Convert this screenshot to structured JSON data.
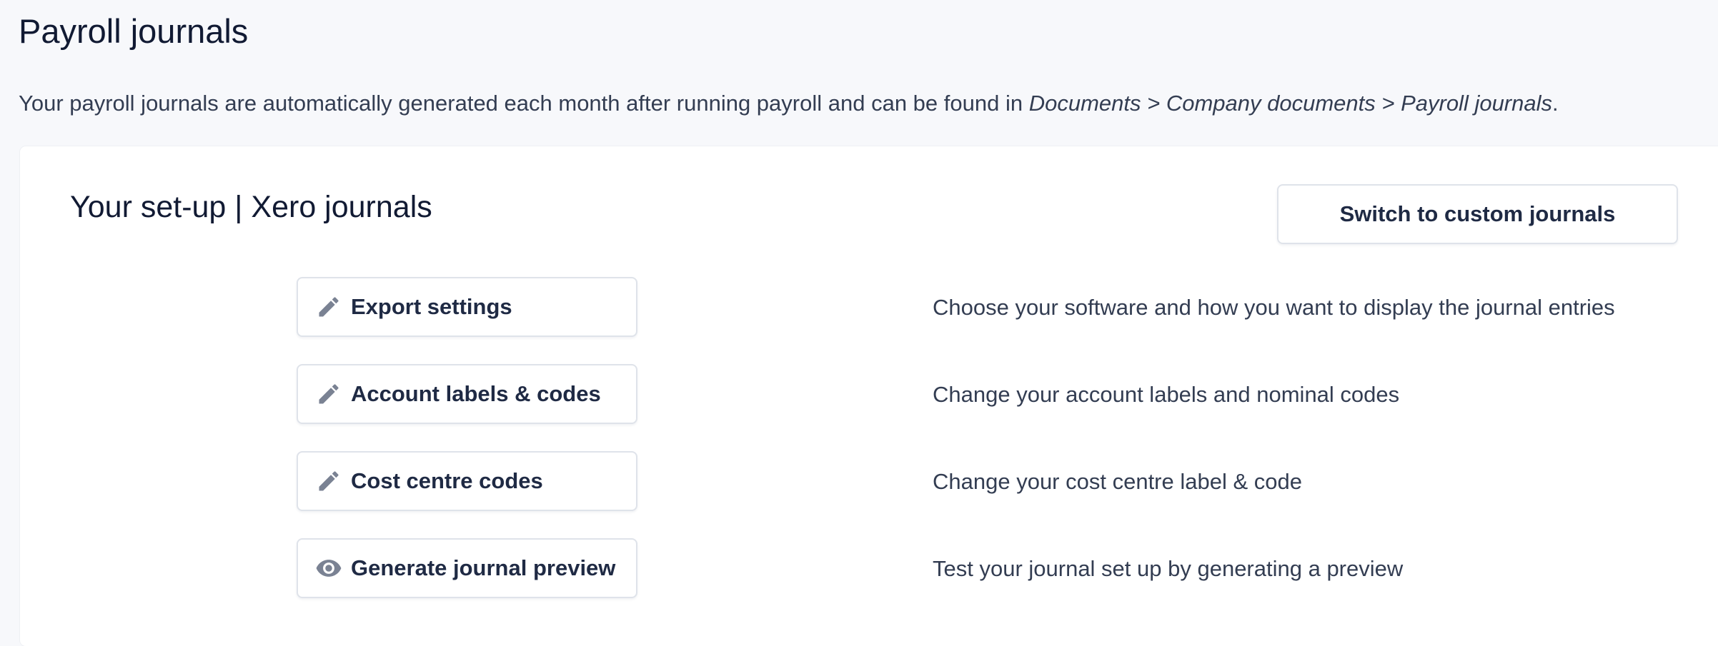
{
  "page": {
    "title": "Payroll journals",
    "intro": {
      "text": "Your payroll journals are automatically generated each month after running payroll and can be found in ",
      "path": "Documents > Company documents > Payroll journals",
      "end": "."
    }
  },
  "setup": {
    "title": "Your set-up | Xero journals",
    "switch_label": "Switch to custom journals"
  },
  "actions": [
    {
      "label": "Export settings",
      "icon": "pencil-icon",
      "description": "Choose your software and how you want to display the journal entries"
    },
    {
      "label": "Account labels & codes",
      "icon": "pencil-icon",
      "description": "Change your account labels and nominal codes"
    },
    {
      "label": "Cost centre codes",
      "icon": "pencil-icon",
      "description": "Change your cost centre label & code"
    },
    {
      "label": "Generate journal preview",
      "icon": "eye-icon",
      "description": "Test your journal set up by generating a preview"
    }
  ],
  "colors": {
    "background": "#f7f8fb",
    "card": "#ffffff",
    "text_primary": "#111a33",
    "text_secondary": "#333d52",
    "icon": "#7a8293",
    "border": "#dfe3ea"
  }
}
